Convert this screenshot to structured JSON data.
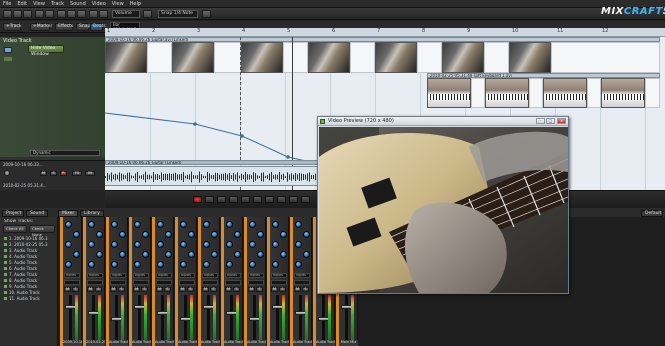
{
  "menu": [
    "File",
    "Edit",
    "View",
    "Track",
    "Sound",
    "Video",
    "View",
    "Help"
  ],
  "toolbar": {
    "dropdown1": "Volume",
    "dropdown2": "Snap 1/4 Note"
  },
  "logo": {
    "text_pre": "MIX",
    "text_mid": "CRAFT",
    "text_post": "5"
  },
  "bar2": {
    "track_btn": "+Track",
    "marker_btn": "+Marker",
    "effects_btn": "Effects",
    "snap_btn": "Snap",
    "beats_btn": "Beats",
    "time_line1": "Bar",
    "time_line2": "120.0  4/4  C"
  },
  "ruler": [
    "1",
    "2",
    "3",
    "4",
    "5",
    "6",
    "7",
    "8",
    "9",
    "10",
    "11",
    "12"
  ],
  "tracks": {
    "video_label": "Video Track",
    "hide_video": "Hide Video Window",
    "automation_label": "Dynamic",
    "audio_name": "2009-10-16 06.33...",
    "audio_name2": "2010-02-25 05.31.4..."
  },
  "clips": {
    "video1": "2009-10-16 06.06.26 Guitar.avi (Linked)",
    "video2": "2010-02-25 05.31.48 soft keyboard 1.avi",
    "audio1": "2009-10-16 06.06.26 Guitar (Linked)"
  },
  "mixer": {
    "tabs": [
      "Project",
      "Sound",
      "Mixer",
      "Library"
    ],
    "show_tracks": "Show Tracks:",
    "check_all": "Check All",
    "check_none": "Check None",
    "track_list": [
      "1. 2009-10-16 06.3",
      "2. 2010-02-25 05.3",
      "3. Audio Track",
      "4. Audio Track",
      "5. Audio Track",
      "6. Audio Track",
      "7. Audio Track",
      "8. Audio Track",
      "9. Audio Track",
      "10. Audio Track",
      "11. Audio Track"
    ],
    "strips": [
      "2009-10-16 06.33...",
      "2010-02-25 05.3...",
      "Audio Track",
      "Audio Track",
      "Audio Track",
      "Audio Track",
      "Audio Track",
      "Audio Track",
      "Audio Track",
      "Audio Track",
      "Audio Track",
      "Audio Track",
      "Main Mix"
    ],
    "inputs_label": "Inputs",
    "right_label": "Default"
  },
  "video_preview": {
    "title": "Video Preview (720 x 480)",
    "minimize": "–",
    "maximize": "□",
    "close": "x"
  },
  "colors": {
    "accent": "#39b8ff",
    "strip_accent": "#d98a2f",
    "timeline_bg": "#e7edf2"
  }
}
